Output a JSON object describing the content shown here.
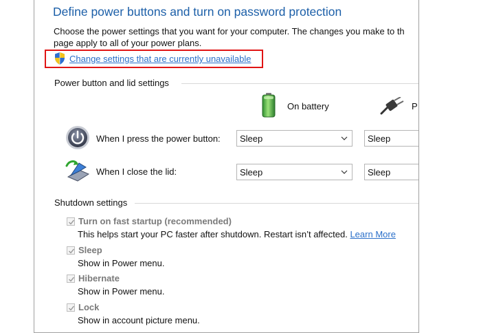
{
  "header": {
    "title": "Define power buttons and turn on password protection",
    "description_line1": "Choose the power settings that you want for your computer. The changes you make to th",
    "description_line2": "page apply to all of your power plans.",
    "change_settings_link": "Change settings that are currently unavailable"
  },
  "power_section": {
    "heading": "Power button and lid settings",
    "columns": {
      "battery": "On battery",
      "plugged": "P"
    },
    "rows": [
      {
        "label": "When I press the power button:",
        "battery_value": "Sleep",
        "plugged_value": "Sleep"
      },
      {
        "label": "When I close the lid:",
        "battery_value": "Sleep",
        "plugged_value": "Sleep"
      }
    ]
  },
  "shutdown_section": {
    "heading": "Shutdown settings",
    "items": [
      {
        "label": "Turn on fast startup (recommended)",
        "checked": true,
        "desc": "This helps start your PC faster after shutdown. Restart isn’t affected.",
        "link": "Learn More"
      },
      {
        "label": "Sleep",
        "checked": true,
        "desc": "Show in Power menu."
      },
      {
        "label": "Hibernate",
        "checked": true,
        "desc": "Show in Power menu."
      },
      {
        "label": "Lock",
        "checked": true,
        "desc": "Show in account picture menu."
      }
    ]
  },
  "colors": {
    "title": "#1c5fa8",
    "link": "#2a6fc9",
    "highlight_box": "#e01414",
    "disabled_text": "#7a7a7a"
  },
  "icons": [
    "shield-icon",
    "battery-icon",
    "plug-icon",
    "power-button-icon",
    "lid-icon",
    "chevron-down-icon",
    "checkmark-icon"
  ]
}
